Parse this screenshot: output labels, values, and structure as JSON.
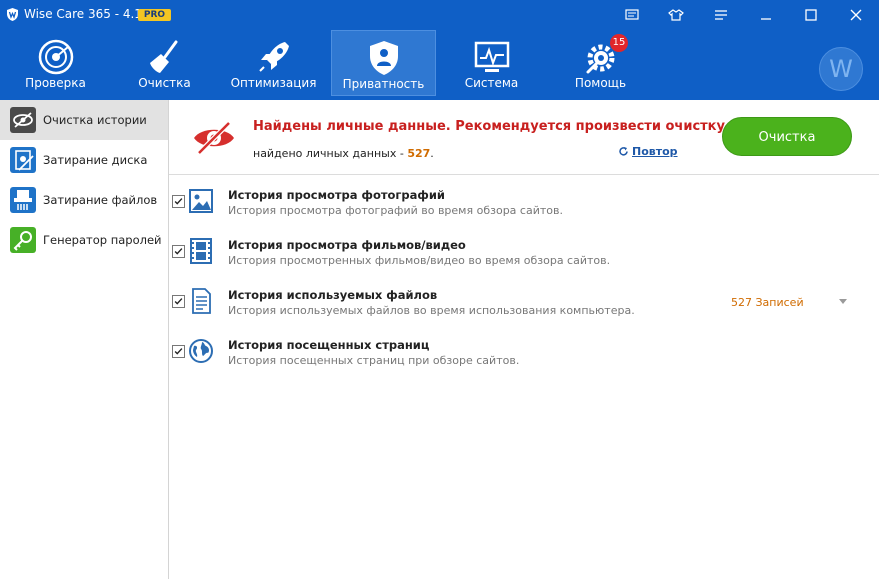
{
  "window": {
    "title": "Wise Care 365 - 4.1.4",
    "badge": "PRO"
  },
  "nav": {
    "items": [
      {
        "label": "Проверка",
        "icon": "radar-icon"
      },
      {
        "label": "Очистка",
        "icon": "broom-icon"
      },
      {
        "label": "Оптимизация",
        "icon": "rocket-icon"
      },
      {
        "label": "Приватность",
        "icon": "shield-icon"
      },
      {
        "label": "Система",
        "icon": "monitor-icon"
      },
      {
        "label": "Помощь",
        "icon": "wrench-gear-icon",
        "badge": "15"
      }
    ],
    "active_index": 3,
    "avatar_letter": "W"
  },
  "sidebar": {
    "items": [
      {
        "label": "Очистка истории",
        "icon": "eye-icon"
      },
      {
        "label": "Затирание диска",
        "icon": "disk-icon"
      },
      {
        "label": "Затирание файлов",
        "icon": "shredder-icon"
      },
      {
        "label": "Генератор паролей",
        "icon": "key-icon"
      }
    ],
    "active_index": 0
  },
  "banner": {
    "alert": "Найдены личные данные. Рекомендуется произвести очистку.",
    "found_label": "найдено личных данных - ",
    "found_count": "527",
    "found_suffix": ".",
    "retry_label": "Повтор",
    "clean_button": "Очистка"
  },
  "history": [
    {
      "title": "История просмотра фотографий",
      "desc": "История просмотра фотографий во время обзора сайтов.",
      "checked": true,
      "icon": "photo-icon",
      "records": ""
    },
    {
      "title": "История просмотра фильмов/видео",
      "desc": "История просмотренных фильмов/видео во время обзора сайтов.",
      "checked": true,
      "icon": "film-icon",
      "records": ""
    },
    {
      "title": "История используемых файлов",
      "desc": "История используемых файлов во время использования компьютера.",
      "checked": true,
      "icon": "document-icon",
      "records": "527 Записей"
    },
    {
      "title": "История посещенных страниц",
      "desc": "История посещенных страниц при обзоре сайтов.",
      "checked": true,
      "icon": "globe-icon",
      "records": ""
    }
  ],
  "colors": {
    "titlebar": "#0f5fc6",
    "nav_active": "#2f78d2",
    "alert": "#c8201f",
    "accent_orange": "#d06b00",
    "clean_button": "#4bb21c",
    "link": "#1e58a8"
  }
}
